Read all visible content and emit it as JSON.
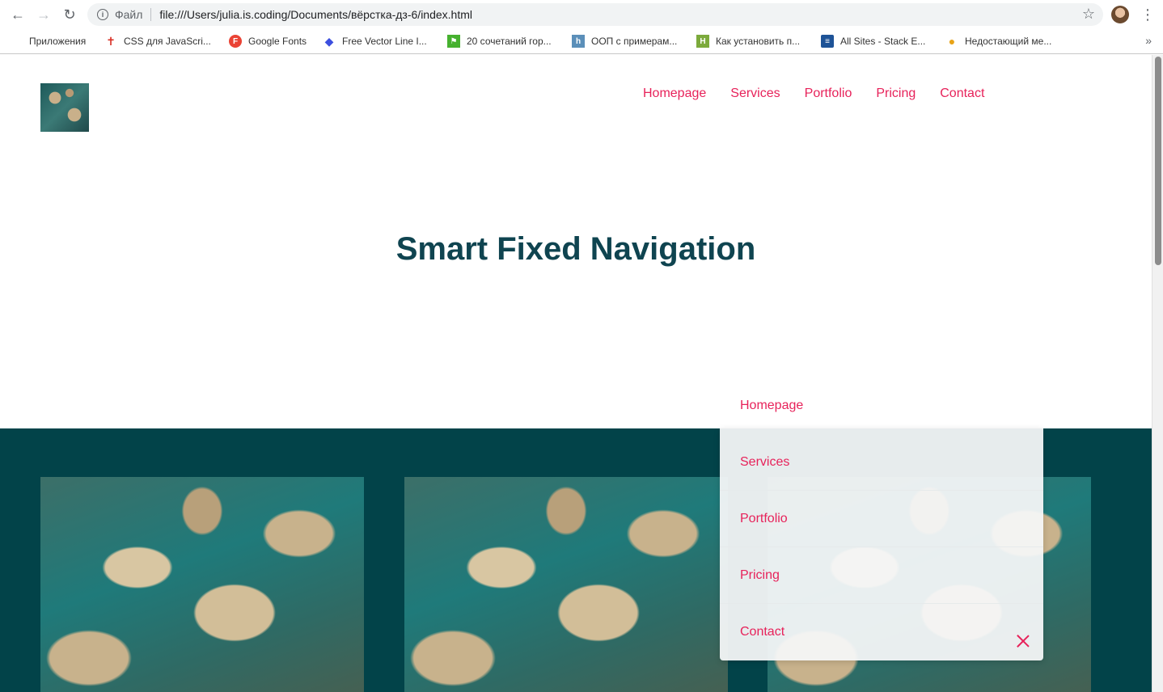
{
  "browser": {
    "scheme_label": "Файл",
    "url": "file:///Users/julia.is.coding/Documents/вёрстка-дз-6/index.html",
    "bookmarks": [
      {
        "label": "Приложения",
        "icon": "apps-grid-icon",
        "color": "#4285f4"
      },
      {
        "label": "CSS для JavaScri...",
        "icon": "css-figure-icon",
        "color": "#d93025"
      },
      {
        "label": "Google Fonts",
        "icon": "google-fonts-icon",
        "color": "#ea4335"
      },
      {
        "label": "Free Vector Line I...",
        "icon": "diamond-icon",
        "color": "#3c4fdf"
      },
      {
        "label": "20 сочетаний гор...",
        "icon": "green-figure-icon",
        "color": "#46b12f"
      },
      {
        "label": "ООП с примерам...",
        "icon": "habr-icon",
        "color": "#5b8fb9"
      },
      {
        "label": "Как установить п...",
        "icon": "hexlet-icon",
        "color": "#7caa3c"
      },
      {
        "label": "All Sites - Stack E...",
        "icon": "stackexchange-icon",
        "color": "#1e5397"
      },
      {
        "label": "Недостающий ме...",
        "icon": "bottle-icon",
        "color": "#e8a317"
      }
    ]
  },
  "page": {
    "nav": [
      "Homepage",
      "Services",
      "Portfolio",
      "Pricing",
      "Contact"
    ],
    "headline": "Smart Fixed Navigation",
    "accent_color": "#e7225a",
    "band_color": "#024349"
  },
  "dropdown": {
    "items": [
      "Homepage",
      "Services",
      "Portfolio",
      "Pricing",
      "Contact"
    ]
  }
}
